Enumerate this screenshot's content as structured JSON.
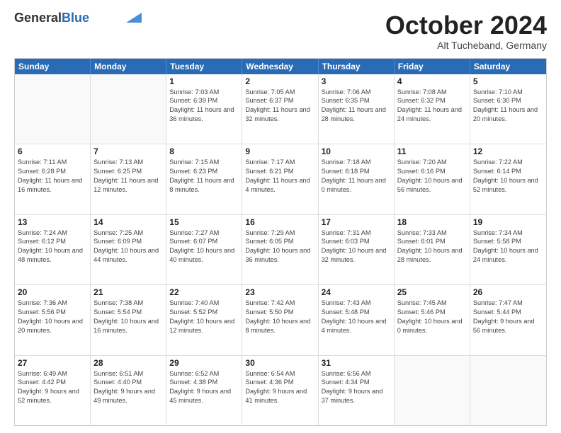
{
  "header": {
    "logo_general": "General",
    "logo_blue": "Blue",
    "month_title": "October 2024",
    "subtitle": "Alt Tucheband, Germany"
  },
  "days_of_week": [
    "Sunday",
    "Monday",
    "Tuesday",
    "Wednesday",
    "Thursday",
    "Friday",
    "Saturday"
  ],
  "weeks": [
    [
      {
        "day": "",
        "empty": true,
        "text": ""
      },
      {
        "day": "",
        "empty": true,
        "text": ""
      },
      {
        "day": "1",
        "text": "Sunrise: 7:03 AM\nSunset: 6:39 PM\nDaylight: 11 hours and 36 minutes."
      },
      {
        "day": "2",
        "text": "Sunrise: 7:05 AM\nSunset: 6:37 PM\nDaylight: 11 hours and 32 minutes."
      },
      {
        "day": "3",
        "text": "Sunrise: 7:06 AM\nSunset: 6:35 PM\nDaylight: 11 hours and 28 minutes."
      },
      {
        "day": "4",
        "text": "Sunrise: 7:08 AM\nSunset: 6:32 PM\nDaylight: 11 hours and 24 minutes."
      },
      {
        "day": "5",
        "text": "Sunrise: 7:10 AM\nSunset: 6:30 PM\nDaylight: 11 hours and 20 minutes."
      }
    ],
    [
      {
        "day": "6",
        "text": "Sunrise: 7:11 AM\nSunset: 6:28 PM\nDaylight: 11 hours and 16 minutes."
      },
      {
        "day": "7",
        "text": "Sunrise: 7:13 AM\nSunset: 6:25 PM\nDaylight: 11 hours and 12 minutes."
      },
      {
        "day": "8",
        "text": "Sunrise: 7:15 AM\nSunset: 6:23 PM\nDaylight: 11 hours and 8 minutes."
      },
      {
        "day": "9",
        "text": "Sunrise: 7:17 AM\nSunset: 6:21 PM\nDaylight: 11 hours and 4 minutes."
      },
      {
        "day": "10",
        "text": "Sunrise: 7:18 AM\nSunset: 6:18 PM\nDaylight: 11 hours and 0 minutes."
      },
      {
        "day": "11",
        "text": "Sunrise: 7:20 AM\nSunset: 6:16 PM\nDaylight: 10 hours and 56 minutes."
      },
      {
        "day": "12",
        "text": "Sunrise: 7:22 AM\nSunset: 6:14 PM\nDaylight: 10 hours and 52 minutes."
      }
    ],
    [
      {
        "day": "13",
        "text": "Sunrise: 7:24 AM\nSunset: 6:12 PM\nDaylight: 10 hours and 48 minutes."
      },
      {
        "day": "14",
        "text": "Sunrise: 7:25 AM\nSunset: 6:09 PM\nDaylight: 10 hours and 44 minutes."
      },
      {
        "day": "15",
        "text": "Sunrise: 7:27 AM\nSunset: 6:07 PM\nDaylight: 10 hours and 40 minutes."
      },
      {
        "day": "16",
        "text": "Sunrise: 7:29 AM\nSunset: 6:05 PM\nDaylight: 10 hours and 36 minutes."
      },
      {
        "day": "17",
        "text": "Sunrise: 7:31 AM\nSunset: 6:03 PM\nDaylight: 10 hours and 32 minutes."
      },
      {
        "day": "18",
        "text": "Sunrise: 7:33 AM\nSunset: 6:01 PM\nDaylight: 10 hours and 28 minutes."
      },
      {
        "day": "19",
        "text": "Sunrise: 7:34 AM\nSunset: 5:58 PM\nDaylight: 10 hours and 24 minutes."
      }
    ],
    [
      {
        "day": "20",
        "text": "Sunrise: 7:36 AM\nSunset: 5:56 PM\nDaylight: 10 hours and 20 minutes."
      },
      {
        "day": "21",
        "text": "Sunrise: 7:38 AM\nSunset: 5:54 PM\nDaylight: 10 hours and 16 minutes."
      },
      {
        "day": "22",
        "text": "Sunrise: 7:40 AM\nSunset: 5:52 PM\nDaylight: 10 hours and 12 minutes."
      },
      {
        "day": "23",
        "text": "Sunrise: 7:42 AM\nSunset: 5:50 PM\nDaylight: 10 hours and 8 minutes."
      },
      {
        "day": "24",
        "text": "Sunrise: 7:43 AM\nSunset: 5:48 PM\nDaylight: 10 hours and 4 minutes."
      },
      {
        "day": "25",
        "text": "Sunrise: 7:45 AM\nSunset: 5:46 PM\nDaylight: 10 hours and 0 minutes."
      },
      {
        "day": "26",
        "text": "Sunrise: 7:47 AM\nSunset: 5:44 PM\nDaylight: 9 hours and 56 minutes."
      }
    ],
    [
      {
        "day": "27",
        "text": "Sunrise: 6:49 AM\nSunset: 4:42 PM\nDaylight: 9 hours and 52 minutes."
      },
      {
        "day": "28",
        "text": "Sunrise: 6:51 AM\nSunset: 4:40 PM\nDaylight: 9 hours and 49 minutes."
      },
      {
        "day": "29",
        "text": "Sunrise: 6:52 AM\nSunset: 4:38 PM\nDaylight: 9 hours and 45 minutes."
      },
      {
        "day": "30",
        "text": "Sunrise: 6:54 AM\nSunset: 4:36 PM\nDaylight: 9 hours and 41 minutes."
      },
      {
        "day": "31",
        "text": "Sunrise: 6:56 AM\nSunset: 4:34 PM\nDaylight: 9 hours and 37 minutes."
      },
      {
        "day": "",
        "empty": true,
        "text": ""
      },
      {
        "day": "",
        "empty": true,
        "text": ""
      }
    ]
  ]
}
